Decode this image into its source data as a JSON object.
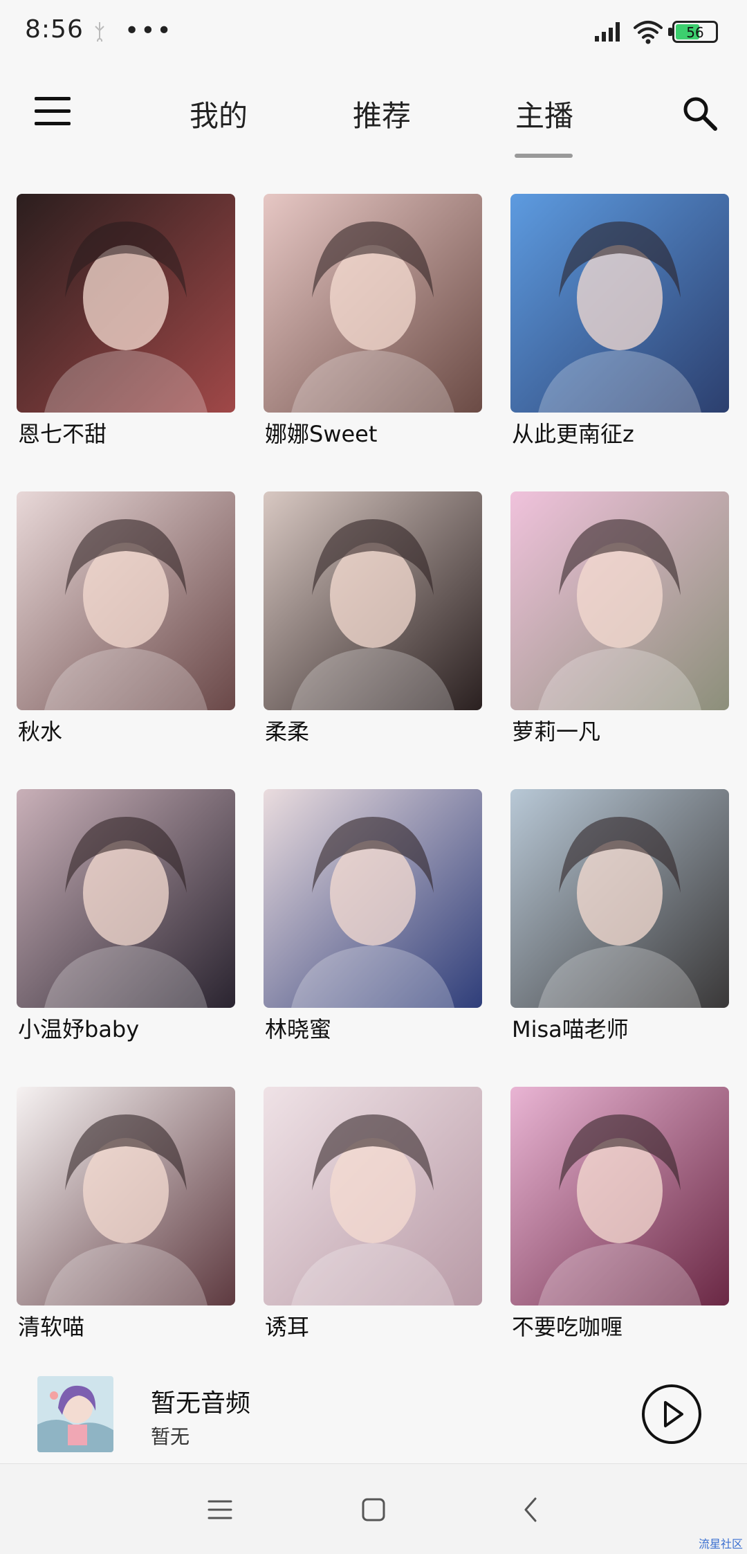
{
  "status_bar": {
    "time": "8:56",
    "dots": "•••",
    "battery": "56"
  },
  "nav": {
    "tabs": [
      {
        "label": "我的"
      },
      {
        "label": "推荐"
      },
      {
        "label": "主播"
      }
    ],
    "selected": "主播"
  },
  "grid": {
    "items": [
      {
        "name": "恩七不甜",
        "c1": "#2b1e1e",
        "c2": "#a04848"
      },
      {
        "name": "娜娜Sweet",
        "c1": "#e6c7c4",
        "c2": "#6b4b45"
      },
      {
        "name": "从此更南征z",
        "c1": "#5d9be0",
        "c2": "#2c3f6e"
      },
      {
        "name": "秋水",
        "c1": "#e8d8d8",
        "c2": "#6a4848"
      },
      {
        "name": "柔柔",
        "c1": "#d8c8c2",
        "c2": "#2a2020"
      },
      {
        "name": "萝莉一凡",
        "c1": "#f0c2dc",
        "c2": "#8c8f7a"
      },
      {
        "name": "小温妤baby",
        "c1": "#c9b0b8",
        "c2": "#2a2430"
      },
      {
        "name": "林晓蜜",
        "c1": "#eadcde",
        "c2": "#2f3e7a"
      },
      {
        "name": "Misa喵老师",
        "c1": "#b8c8d6",
        "c2": "#3a3838"
      },
      {
        "name": "清软喵",
        "c1": "#f6f2f2",
        "c2": "#5e3a40"
      },
      {
        "name": "诱耳",
        "c1": "#efe2e6",
        "c2": "#b89aa6"
      },
      {
        "name": "不要吃咖喱",
        "c1": "#e9b5d4",
        "c2": "#6a2844"
      }
    ]
  },
  "player": {
    "title": "暂无音频",
    "subtitle": "暂无"
  },
  "watermark": "流星社区"
}
